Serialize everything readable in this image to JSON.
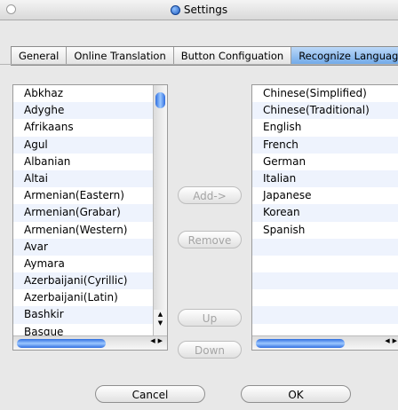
{
  "window": {
    "title": "Settings"
  },
  "tabs": [
    {
      "label": "General"
    },
    {
      "label": "Online Translation"
    },
    {
      "label": "Button Configuation"
    },
    {
      "label": "Recognize Language"
    }
  ],
  "available_languages": [
    "Abkhaz",
    "Adyghe",
    "Afrikaans",
    "Agul",
    "Albanian",
    "Altai",
    "Armenian(Eastern)",
    "Armenian(Grabar)",
    "Armenian(Western)",
    "Avar",
    "Aymara",
    "Azerbaijani(Cyrillic)",
    "Azerbaijani(Latin)",
    "Bashkir",
    "Basque"
  ],
  "selected_languages": [
    "Chinese(Simplified)",
    "Chinese(Traditional)",
    "English",
    "French",
    "German",
    "Italian",
    "Japanese",
    "Korean",
    "Spanish"
  ],
  "buttons": {
    "add": "Add->",
    "remove": "Remove",
    "up": "Up",
    "down": "Down",
    "cancel": "Cancel",
    "ok": "OK"
  },
  "scroll_arrows": {
    "up": "▲",
    "down": "▼",
    "left": "◀",
    "right": "▶"
  },
  "colors": {
    "active_tab": "#6ea8e8",
    "scroll_thumb": "#2f6ee0"
  }
}
